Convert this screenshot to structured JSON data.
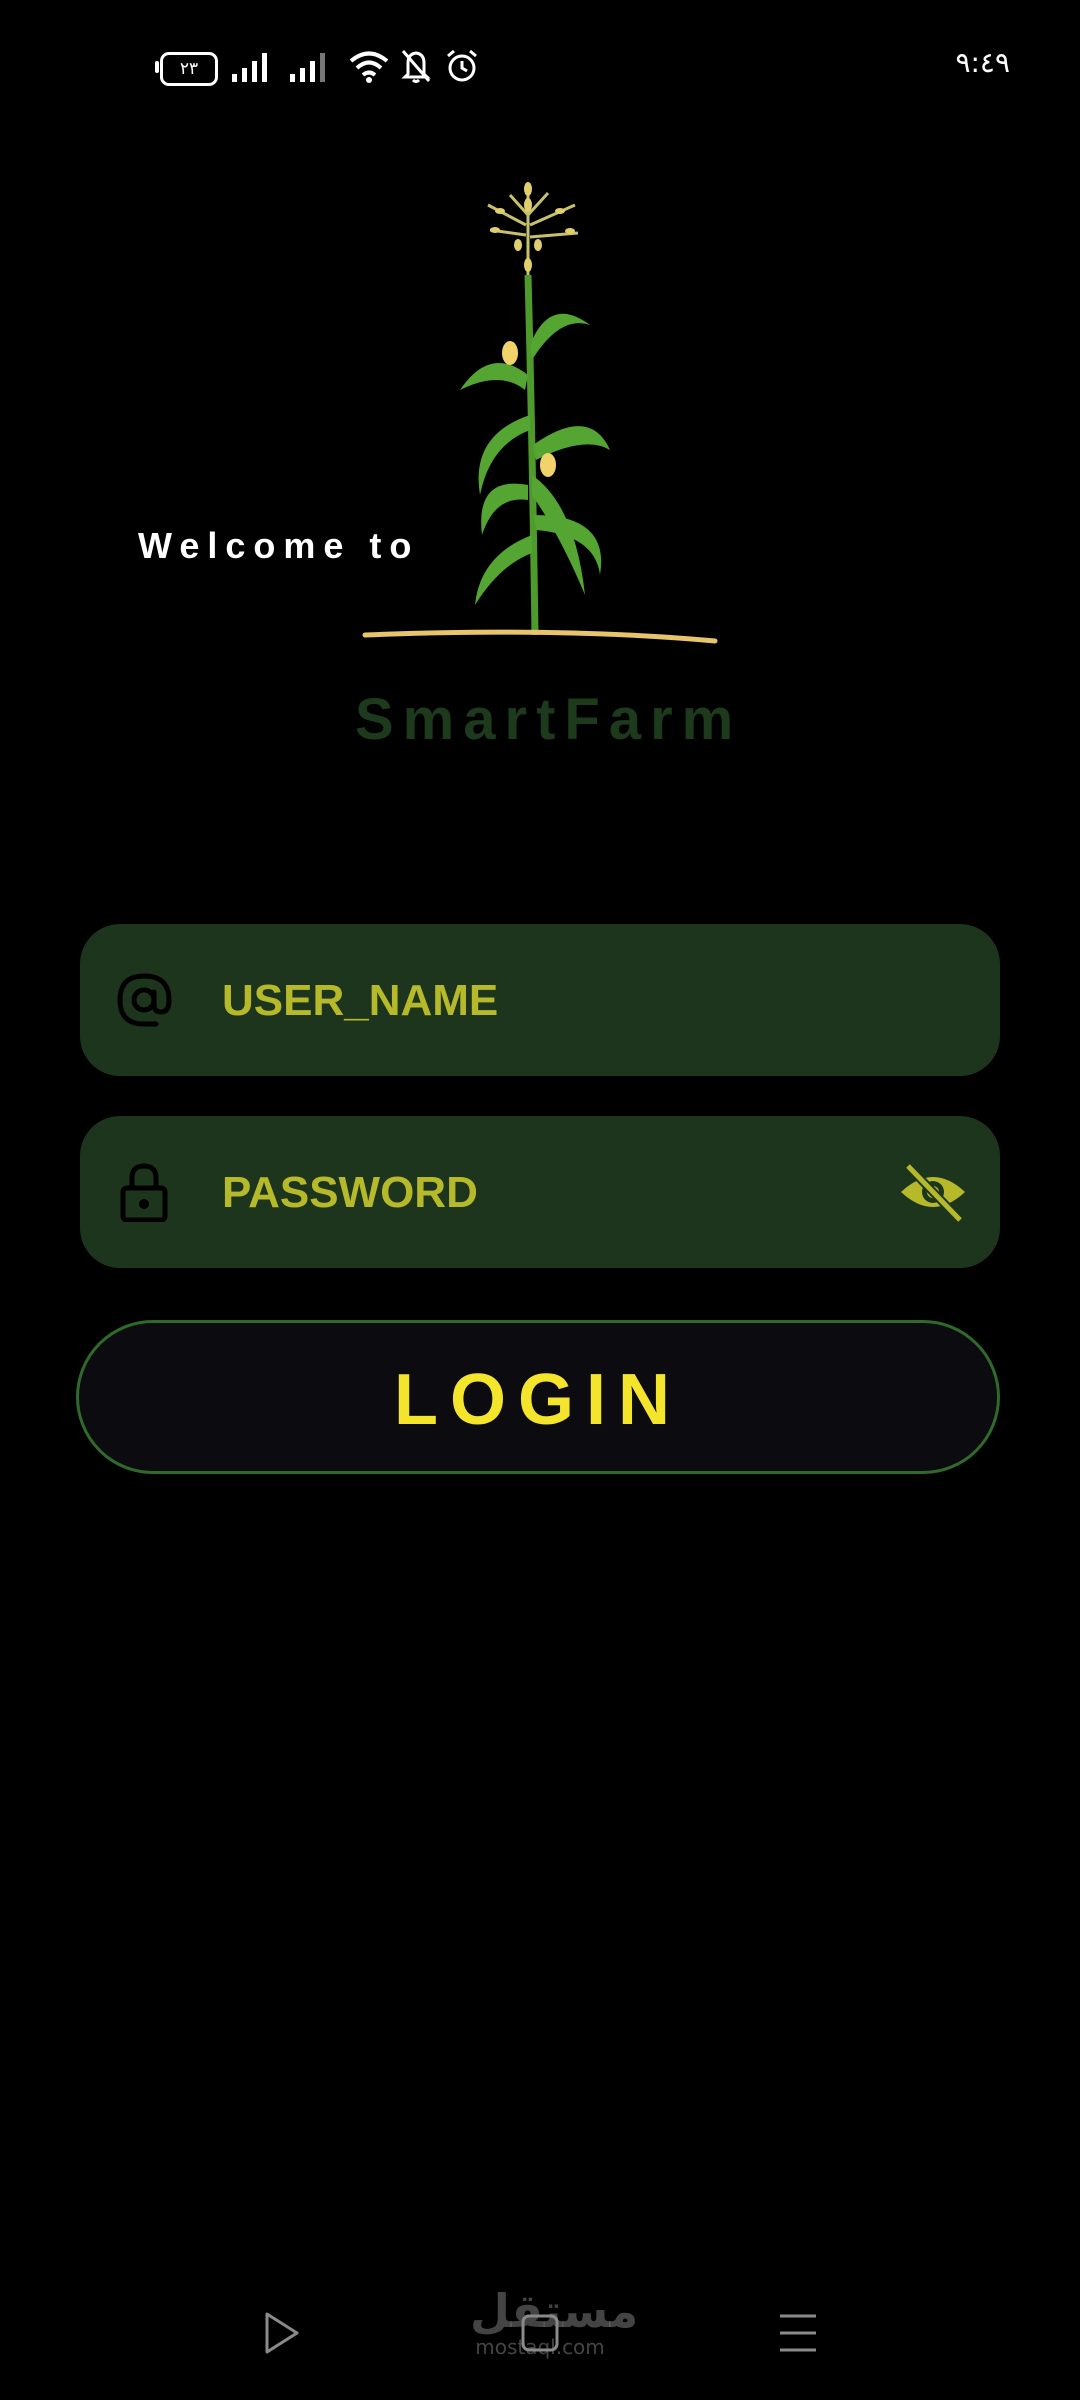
{
  "status_bar": {
    "battery_level": "٢٣",
    "time": "٩:٤٩"
  },
  "header": {
    "welcome_text": "Welcome to",
    "app_name": "SmartFarm"
  },
  "form": {
    "username_placeholder": "USER_NAME",
    "password_placeholder": "PASSWORD",
    "login_label": "LOGIN"
  },
  "watermark": {
    "arabic": "مستقل",
    "latin": "mostaql.com"
  },
  "colors": {
    "background": "#000000",
    "field_bg": "#1e351d",
    "field_text": "#b5b92a",
    "login_text": "#f4e52c",
    "login_border": "#2f6a2a",
    "app_name": "#1e3a1d"
  },
  "icons": {
    "username": "at-icon",
    "password": "lock-icon",
    "visibility": "eye-off-icon"
  }
}
